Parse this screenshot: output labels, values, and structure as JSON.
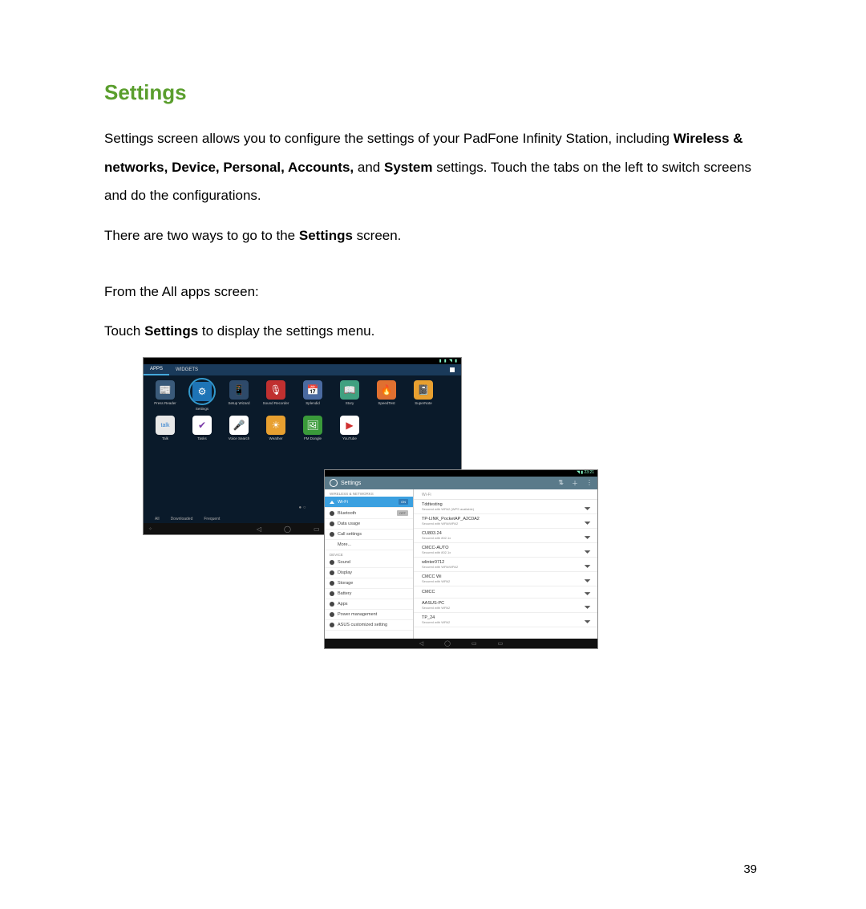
{
  "heading": "Settings",
  "para1_a": "Settings screen allows you to configure the settings of your PadFone Infinity Station, including ",
  "para1_b1": "Wireless & networks, Device, Personal, Accounts,",
  "para1_b2": " and ",
  "para1_b3": "System",
  "para1_c": " settings. Touch the tabs on the left to switch screens and do the configurations.",
  "para2_a": "There are two ways to go to the ",
  "para2_b": "Settings",
  "para2_c": " screen.",
  "para3": "From the All apps screen:",
  "para4_a": "Touch ",
  "para4_b": "Settings",
  "para4_c": " to display the settings menu.",
  "page_number": "39",
  "screen1": {
    "tabs": {
      "apps": "APPS",
      "widgets": "WIDGETS"
    },
    "apps_row1": [
      {
        "label": "Press Reader",
        "color": "#3a5a7a",
        "glyph": "📰"
      },
      {
        "label": "Settings",
        "color": "#1e74b6",
        "glyph": "⚙"
      },
      {
        "label": "Setup Wizard",
        "color": "#2e4a6a",
        "glyph": "📱"
      },
      {
        "label": "Sound Recorder",
        "color": "#c03030",
        "glyph": "🎙"
      },
      {
        "label": "Splendid",
        "color": "#4a6aa0",
        "glyph": "📅"
      },
      {
        "label": "Story",
        "color": "#40a080",
        "glyph": "📖"
      },
      {
        "label": "SpeedTest",
        "color": "#e07030",
        "glyph": "🔥"
      },
      {
        "label": "SuperNote",
        "color": "#e8a030",
        "glyph": "📓"
      }
    ],
    "apps_row2": [
      {
        "label": "Talk",
        "color": "#e8e8e8",
        "glyph": "talk",
        "text_color": "#3080d0"
      },
      {
        "label": "Tasks",
        "color": "#fff",
        "glyph": "✔",
        "text_color": "#7a3aa8"
      },
      {
        "label": "Voice Search",
        "color": "#fff",
        "glyph": "🎤",
        "text_color": "#3a7ae0"
      },
      {
        "label": "Weather",
        "color": "#e8a030",
        "glyph": "☀"
      },
      {
        "label": "FM Dongle",
        "color": "#3a9a3a",
        "glyph": "🖼"
      },
      {
        "label": "YouTube",
        "color": "#fff",
        "glyph": "▶",
        "text_color": "#d03030"
      }
    ],
    "filters": [
      "All",
      "Downloaded",
      "Frequent"
    ]
  },
  "screen2": {
    "status_time": "23:21",
    "title": "Settings",
    "actions": [
      "⇅",
      "＋",
      "⋮"
    ],
    "section1": "WIRELESS & NETWORKS",
    "section2": "DEVICE",
    "left": {
      "wifi": {
        "label": "Wi-Fi",
        "toggle": "ON"
      },
      "bluetooth": {
        "label": "Bluetooth",
        "toggle": "OFF"
      },
      "data": {
        "label": "Data usage"
      },
      "call": {
        "label": "Call settings"
      },
      "more": {
        "label": "More..."
      },
      "sound": {
        "label": "Sound"
      },
      "display": {
        "label": "Display"
      },
      "storage": {
        "label": "Storage"
      },
      "battery": {
        "label": "Battery"
      },
      "apps": {
        "label": "Apps"
      },
      "power": {
        "label": "Power management"
      },
      "asus": {
        "label": "ASUS customized setting"
      }
    },
    "right_header": "Wi-Fi",
    "networks": [
      {
        "name": "Tddtesting",
        "sec": "Secured with WPA2 (WPS available)"
      },
      {
        "name": "TP-LINK_PocketAP_A2C0A2",
        "sec": "Secured with WPA/WPA2"
      },
      {
        "name": "CU803.24",
        "sec": "Secured with 802.1x"
      },
      {
        "name": "CMCC-AUTO",
        "sec": "Secured with 802.1x"
      },
      {
        "name": "wlinter0712",
        "sec": "Secured with WPA/WPA2"
      },
      {
        "name": "CMCC Wi",
        "sec": "Secured with WPA2"
      },
      {
        "name": "CMCC",
        "sec": ""
      },
      {
        "name": "AASUS-PC",
        "sec": "Secured with WPA2"
      },
      {
        "name": "TP_24",
        "sec": "Secured with WPA2"
      }
    ]
  }
}
